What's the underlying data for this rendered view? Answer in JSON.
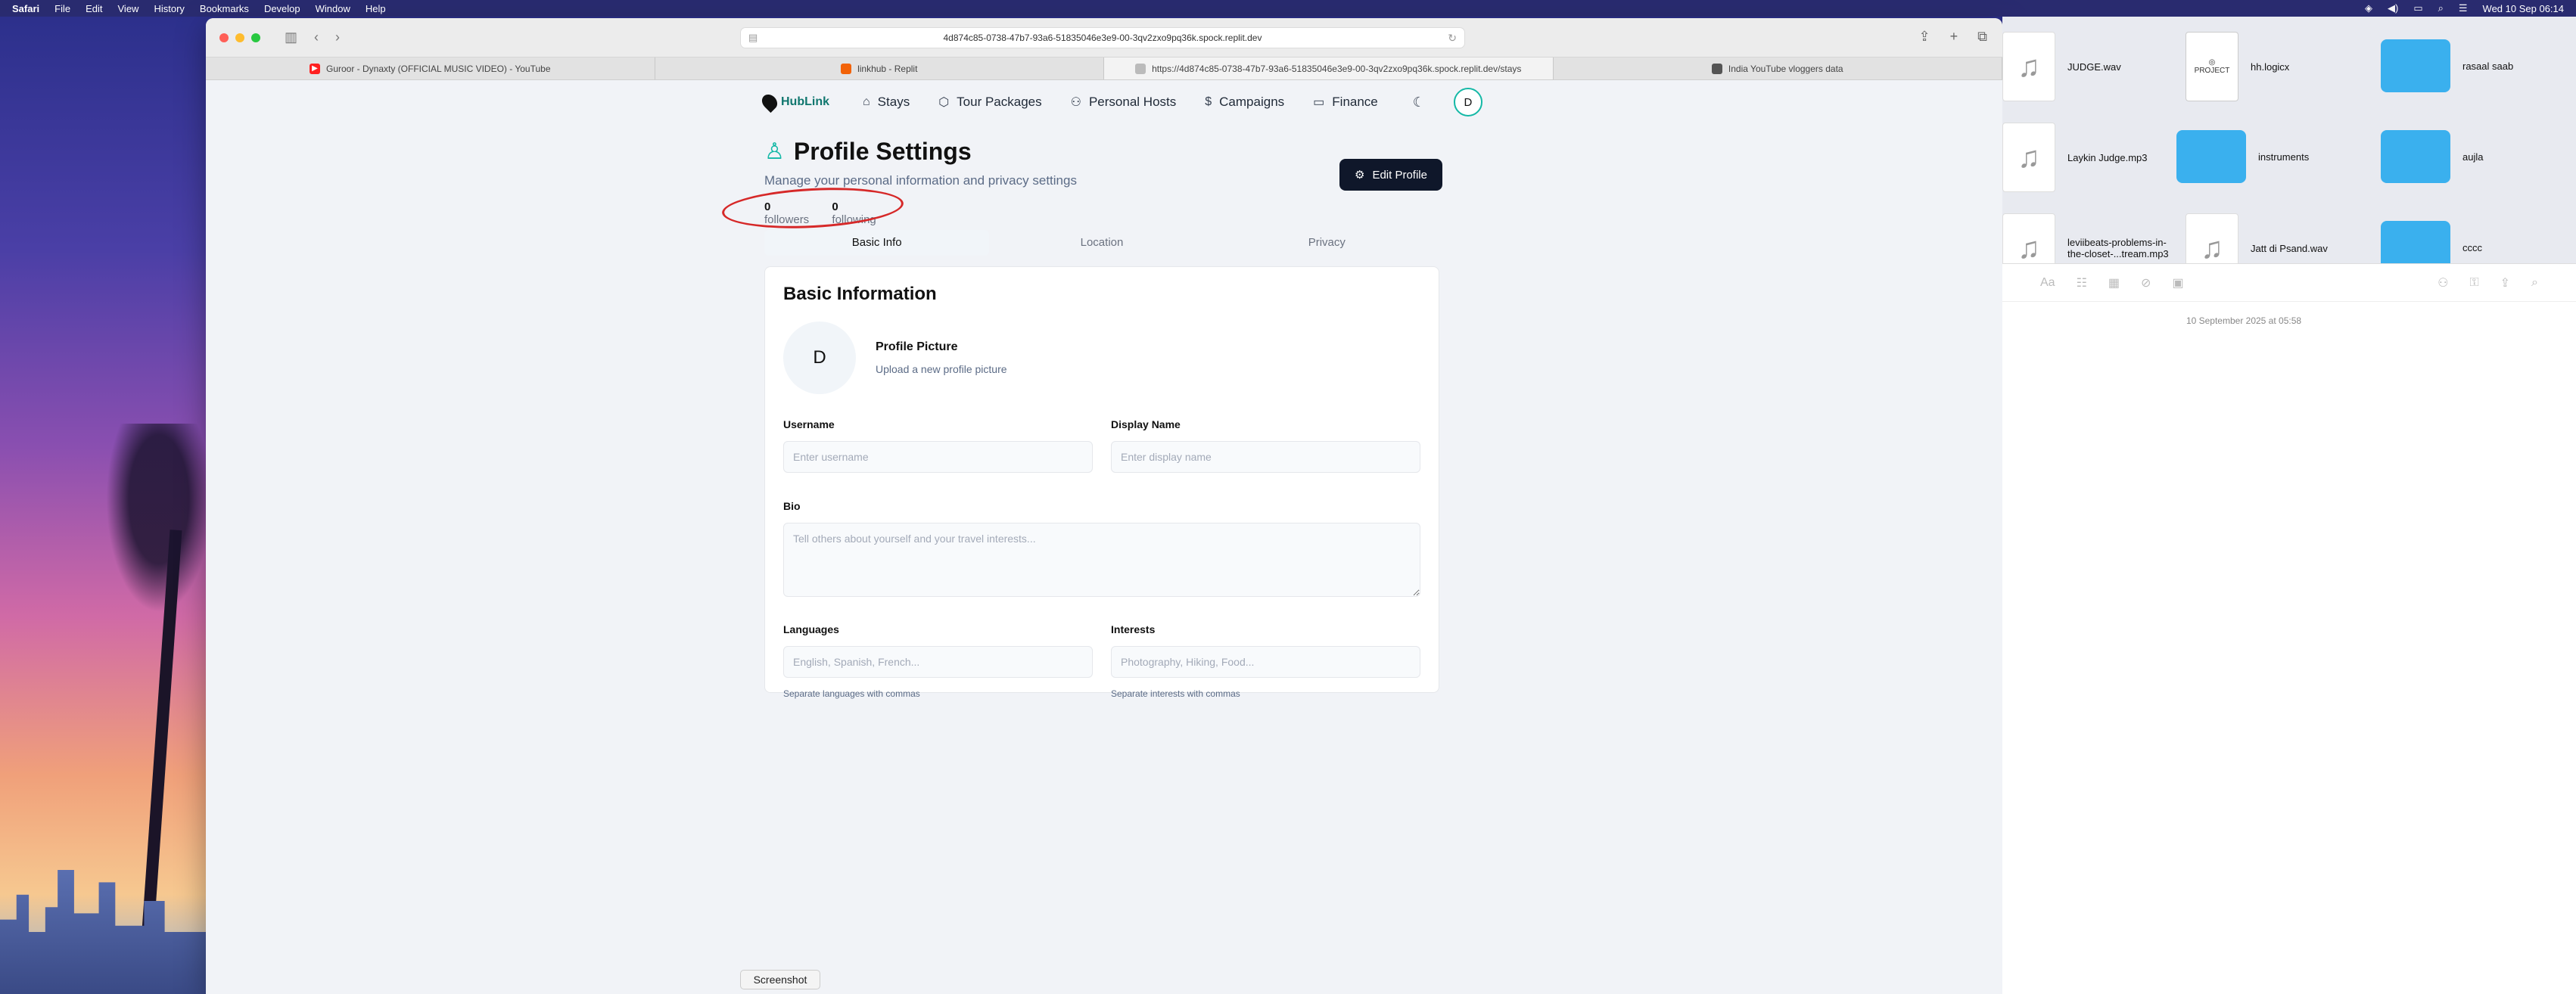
{
  "menubar": {
    "app": "Safari",
    "items": [
      "File",
      "Edit",
      "View",
      "History",
      "Bookmarks",
      "Develop",
      "Window",
      "Help"
    ],
    "clock": "Wed 10 Sep 06:14"
  },
  "browser": {
    "url": "4d874c85-0738-47b7-93a6-51835046e3e9-00-3qv2zxo9pq36k.spock.replit.dev",
    "tabs": [
      {
        "label": "Guroor - Dynaxty (OFFICIAL MUSIC VIDEO) - YouTube",
        "favicon": "youtube-icon"
      },
      {
        "label": "linkhub - Replit",
        "favicon": "replit-icon"
      },
      {
        "label": "https://4d874c85-0738-47b7-93a6-51835046e3e9-00-3qv2zxo9pq36k.spock.replit.dev/stays",
        "favicon": "page-icon"
      },
      {
        "label": "India YouTube vloggers data",
        "favicon": "globe-icon"
      }
    ]
  },
  "app": {
    "brand": "HubLink",
    "nav": [
      {
        "label": "Stays",
        "icon": "home-icon"
      },
      {
        "label": "Tour Packages",
        "icon": "package-icon"
      },
      {
        "label": "Personal Hosts",
        "icon": "user-check-icon"
      },
      {
        "label": "Campaigns",
        "icon": "dollar-icon"
      },
      {
        "label": "Finance",
        "icon": "card-icon"
      }
    ],
    "avatar_initial": "D"
  },
  "profile": {
    "title": "Profile Settings",
    "subtitle": "Manage your personal information and privacy settings",
    "followers_count": "0",
    "followers_label": "followers",
    "following_count": "0",
    "following_label": "following",
    "edit_button": "Edit Profile",
    "tabs": [
      "Basic Info",
      "Location",
      "Privacy"
    ],
    "active_tab": "Basic Info"
  },
  "basic_info": {
    "heading": "Basic Information",
    "avatar_initial": "D",
    "picture_title": "Profile Picture",
    "picture_sub": "Upload a new profile picture",
    "username_label": "Username",
    "username_placeholder": "Enter username",
    "display_name_label": "Display Name",
    "display_name_placeholder": "Enter display name",
    "bio_label": "Bio",
    "bio_placeholder": "Tell others about yourself and your travel interests...",
    "languages_label": "Languages",
    "languages_placeholder": "English, Spanish, French...",
    "languages_hint": "Separate languages with commas",
    "interests_label": "Interests",
    "interests_placeholder": "Photography, Hiking, Food...",
    "interests_hint": "Separate interests with commas"
  },
  "screenshot_label": "Screenshot",
  "desktop": {
    "files": [
      {
        "name": "JUDGE.wav",
        "type": "audio"
      },
      {
        "name": "hh.logicx",
        "type": "project",
        "badge": "PROJECT"
      },
      {
        "name": "rasaal saab",
        "type": "folder"
      },
      {
        "name": "Laykin Judge.mp3",
        "type": "audio"
      },
      {
        "name": "instruments",
        "type": "folder"
      },
      {
        "name": "aujla",
        "type": "folder"
      },
      {
        "name": "leviibeats-problems-in-the-closet-...tream.mp3",
        "type": "audio"
      },
      {
        "name": "Jatt di Psand.wav",
        "type": "audio"
      },
      {
        "name": "cccc",
        "type": "folder"
      }
    ],
    "notes_date": "10 September 2025 at 05:58"
  },
  "colors": {
    "accent": "#14b8a6",
    "annotation": "#d62828",
    "button_dark": "#0f172a"
  }
}
